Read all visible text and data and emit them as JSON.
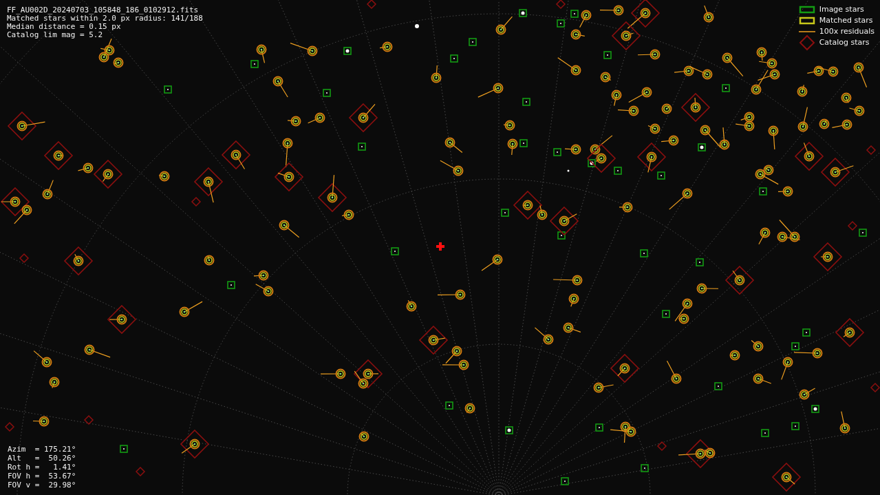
{
  "header_lines": [
    "FF_AU002D_20240703_105848_186_0102912.fits",
    "Matched stars within 2.0 px radius: 141/188",
    "Median distance = 0.15 px",
    "Catalog lim mag = 5.2"
  ],
  "legend": [
    {
      "kind": "image",
      "label": "Image stars"
    },
    {
      "kind": "matched",
      "label": "Matched stars"
    },
    {
      "kind": "residual",
      "label": "100x residuals"
    },
    {
      "kind": "catalog",
      "label": "Catalog stars"
    }
  ],
  "pointing_lines": [
    "Azim  = 175.21°",
    "Alt   =  50.26°",
    "Rot h =   1.41°",
    "FOV h =  53.67°",
    "FOV v =  29.98°"
  ]
}
